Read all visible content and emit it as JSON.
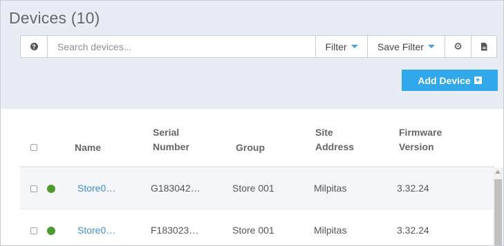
{
  "page": {
    "title": "Devices (10)"
  },
  "toolbar": {
    "help_icon": "question-circle-icon",
    "search_placeholder": "Search devices...",
    "search_value": "",
    "filter_label": "Filter",
    "save_filter_label": "Save Filter",
    "settings_icon": "gear-icon",
    "export_icon": "document-icon",
    "accent_color": "#31a8ea"
  },
  "actions": {
    "add_device_label": "Add Device",
    "add_icon": "plus-square-icon"
  },
  "table": {
    "headers": {
      "name": "Name",
      "serial_line1": "Serial",
      "serial_line2": "Number",
      "group": "Group",
      "site_line1": "Site",
      "site_line2": "Address",
      "fw_line1": "Firmware",
      "fw_line2": "Version"
    },
    "rows": [
      {
        "status_color": "#4f9a2c",
        "name": "Store0…",
        "serial": "G183042…",
        "group": "Store 001",
        "site": "Milpitas",
        "firmware": "3.32.24"
      },
      {
        "status_color": "#4f9a2c",
        "name": "Store0…",
        "serial": "F183023…",
        "group": "Store 001",
        "site": "Milpitas",
        "firmware": "3.32.24"
      }
    ]
  }
}
